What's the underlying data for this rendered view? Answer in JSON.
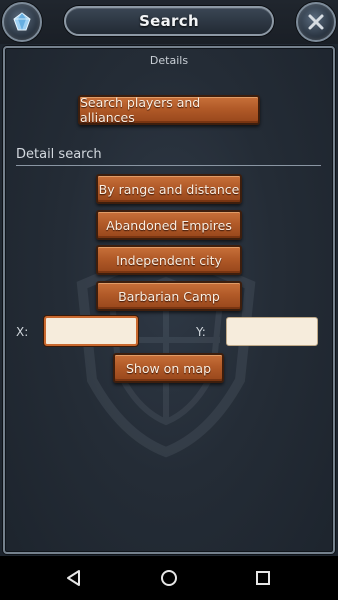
{
  "header": {
    "title": "Search",
    "left_icon": "crystal-icon",
    "right_icon": "close-icon"
  },
  "panel": {
    "subtitle": "Details"
  },
  "search_players_label": "Search players and alliances",
  "detail_search": {
    "heading": "Detail search",
    "buttons": [
      "By range and distance",
      "Abandoned Empires",
      "Independent city",
      "Barbarian Camp"
    ]
  },
  "coordinates": {
    "x_label": "X:",
    "y_label": "Y:",
    "x_value": "",
    "y_value": ""
  },
  "show_on_map_label": "Show on map",
  "nav": {
    "back_icon": "back-icon",
    "home_icon": "home-icon",
    "recents_icon": "recents-icon"
  },
  "colors": {
    "button_wood": "#b15a28",
    "input_background": "#f6ecdc",
    "panel_background": "#242c36"
  }
}
